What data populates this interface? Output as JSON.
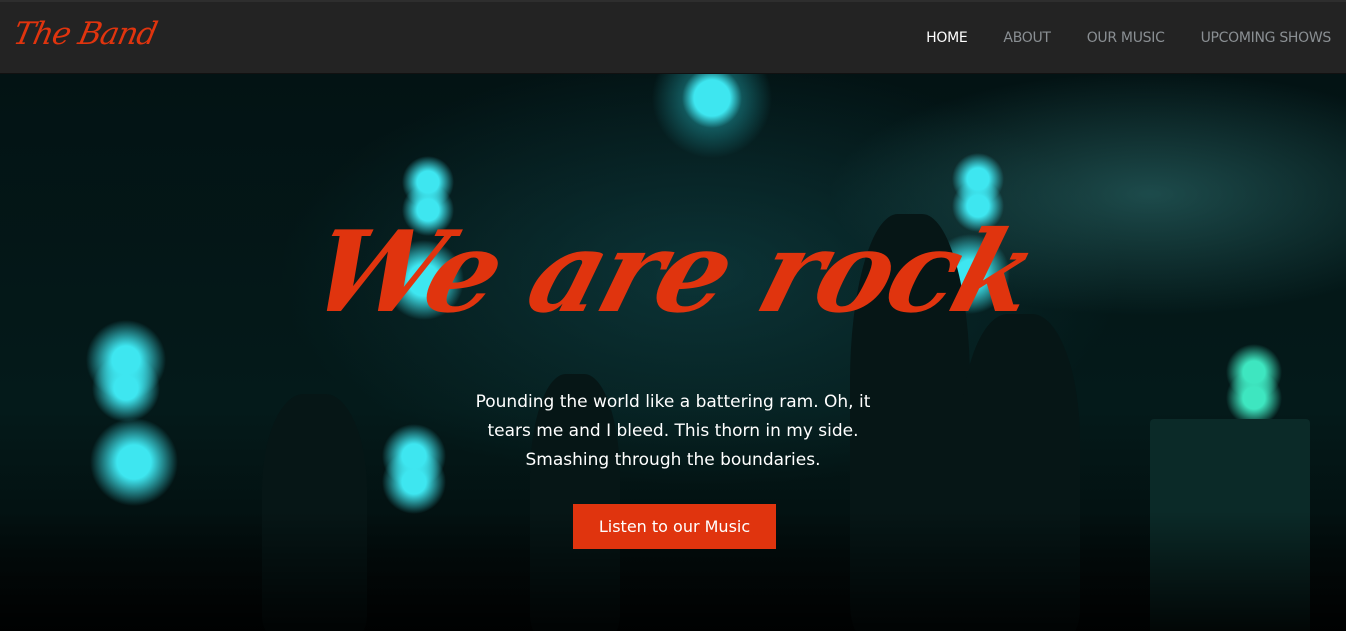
{
  "nav": {
    "logo": "The Band",
    "items": [
      {
        "label": "HOME",
        "active": true
      },
      {
        "label": "ABOUT"
      },
      {
        "label": "OUR MUSIC"
      },
      {
        "label": "UPCOMING SHOWS"
      }
    ]
  },
  "hero": {
    "title": "We are rock",
    "subtitle": "Pounding the world like a battering ram. Oh, it tears me and I bleed. This thorn in my side. Smashing through the boundaries.",
    "cta": "Listen to our Music"
  },
  "colors": {
    "accent": "#e0340e",
    "nav_bg": "#232323"
  }
}
